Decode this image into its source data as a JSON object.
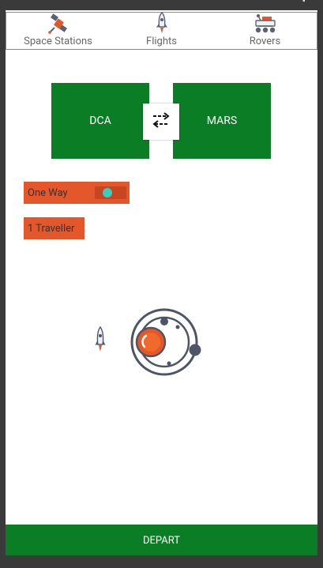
{
  "tabs": [
    {
      "label": "Space Stations",
      "icon": "satellite-icon"
    },
    {
      "label": "Flights",
      "icon": "rocket-icon"
    },
    {
      "label": "Rovers",
      "icon": "rover-icon"
    }
  ],
  "route": {
    "from": "DCA",
    "to": "MARS",
    "swap_icon": "swap-arrows-icon"
  },
  "trip_type": {
    "label": "One Way"
  },
  "travellers": {
    "label": "1 Traveller"
  },
  "action": {
    "depart_label": "DEPART"
  },
  "colors": {
    "primary_green": "#0b7d24",
    "accent_orange": "#e3572a",
    "toggle_knob": "#35d0c0"
  }
}
